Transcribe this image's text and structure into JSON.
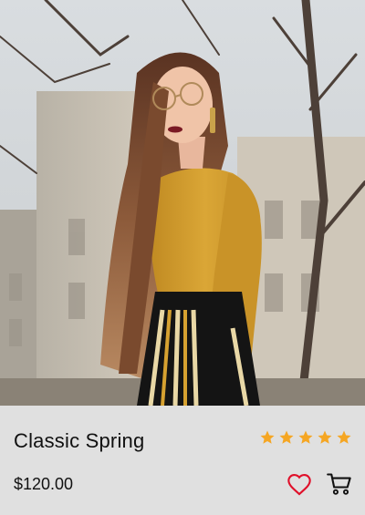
{
  "product": {
    "image_alt": "Woman with long hair wearing a mustard ribbed sweater and striped skirt",
    "title": "Classic Spring",
    "price": "$120.00",
    "rating": 5,
    "rating_max": 5
  },
  "icons": {
    "star": "star-icon",
    "wishlist": "heart-icon",
    "cart": "cart-icon"
  },
  "colors": {
    "info_bg": "#e0e0e0",
    "star": "#f5a623",
    "heart": "#e0102a",
    "text": "#111111",
    "sweater": "#d6a130"
  }
}
